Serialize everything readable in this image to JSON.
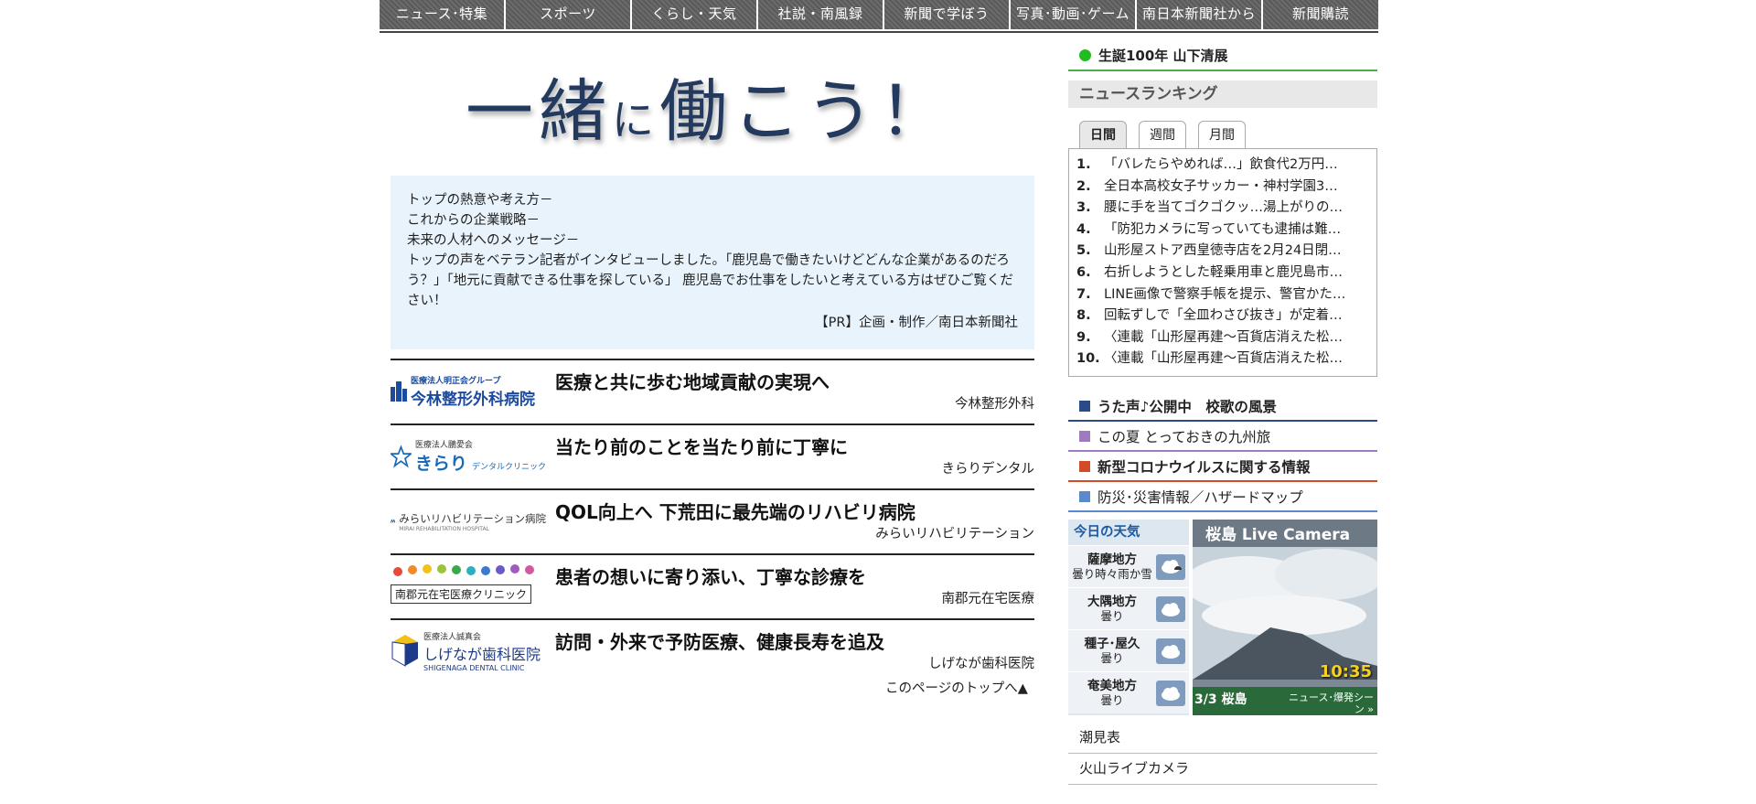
{
  "nav": [
    "ニュース･特集",
    "スポーツ",
    "くらし・天気",
    "社説・南風録",
    "新聞で学ぼう",
    "写真･動画･ゲーム",
    "南日本新聞社から",
    "新聞購読"
  ],
  "hero": {
    "part1": "一緒",
    "part2": "に",
    "part3": "働こう！"
  },
  "intro": {
    "lines": [
      "トップの熱意や考え方－",
      "これからの企業戦略－",
      "未来の人材へのメッセージ－"
    ],
    "body": "トップの声をベテラン記者がインタビューしました。「鹿児島で働きたいけどどんな企業があるのだろう？」「地元に貢献できる仕事を探している」 鹿児島でお仕事をしたいと考えている方はぜひご覧ください！",
    "pr": "【PR】企画・制作／南日本新聞社"
  },
  "articles": [
    {
      "logo_sub": "医療法人明正会グループ",
      "logo_main": "今林整形外科病院",
      "headline": "医療と共に歩む地域貢献の実現へ",
      "sponsor": "今林整形外科"
    },
    {
      "logo_sub": "医療法人鵬愛会",
      "logo_main": "きらり",
      "logo_tag": "デンタルクリニック",
      "headline": "当たり前のことを当たり前に丁寧に",
      "sponsor": "きらりデンタル"
    },
    {
      "logo_main": "みらいリハビリテーション病院",
      "logo_sub": "MIRAI REHABILITATION HOSPITAL",
      "headline": "QOL向上へ 下荒田に最先端のリハビリ病院",
      "sponsor": "みらいリハビリテーション"
    },
    {
      "logo_main": "南郡元在宅医療クリニック",
      "headline": "患者の想いに寄り添い、丁寧な診療を",
      "sponsor": "南郡元在宅医療"
    },
    {
      "logo_sub": "医療法人誠真会",
      "logo_main": "しげなが歯科医院",
      "logo_tag": "SHIGENAGA DENTAL CLINIC",
      "headline": "訪問・外来で予防医療、健康長寿を追及",
      "sponsor": "しげなが歯科医院"
    }
  ],
  "page_top": "このページのトップへ▲",
  "sidebar": {
    "birth": "生誕100年 山下清展",
    "ranking_title": "ニュースランキング",
    "tabs": [
      "日間",
      "週間",
      "月間"
    ],
    "ranking": [
      {
        "num": "1.",
        "text": "「バレたらやめれば…」飲食代2万円…"
      },
      {
        "num": "2.",
        "text": "全日本高校女子サッカー・神村学園3…"
      },
      {
        "num": "3.",
        "text": "腰に手を当てゴクゴクッ…湯上がりの…"
      },
      {
        "num": "4.",
        "text": "「防犯カメラに写っていても逮捕は難…"
      },
      {
        "num": "5.",
        "text": "山形屋ストア西皇徳寺店を2月24日閉…"
      },
      {
        "num": "6.",
        "text": "右折しようとした軽乗用車と鹿児島市…"
      },
      {
        "num": "7.",
        "text": "LINE画像で警察手帳を提示、警官かた…"
      },
      {
        "num": "8.",
        "text": "回転ずしで「全皿わさび抜き」が定着…"
      },
      {
        "num": "9.",
        "text": "〈連載「山形屋再建～百貨店消えた松…"
      },
      {
        "num": "10.",
        "text": "〈連載「山形屋再建～百貨店消えた松…"
      }
    ],
    "banners": [
      {
        "label": "うた声♪公開中　校歌の風景",
        "color": "#2a4a8a"
      },
      {
        "label": "この夏 とっておきの九州旅",
        "color": "#a07ac0"
      },
      {
        "label": "新型コロナウイルスに関する情報",
        "color": "#d24a2a"
      },
      {
        "label": "防災･災害情報／ハザードマップ",
        "color": "#5a8acc"
      }
    ],
    "weather": {
      "title": "今日の天気",
      "areas": [
        {
          "name": "薩摩地方",
          "cond": "曇り時々雨か雪"
        },
        {
          "name": "大隅地方",
          "cond": "曇り"
        },
        {
          "name": "種子･屋久",
          "cond": "曇り"
        },
        {
          "name": "奄美地方",
          "cond": "曇り"
        }
      ]
    },
    "camera": {
      "title": "桜島 Live Camera",
      "time": "10:35",
      "caption1": "3/3 桜島",
      "caption2": "ニュース･爆発シーン »"
    },
    "links": [
      "潮見表",
      "火山ライブカメラ"
    ]
  },
  "colors": {
    "nav_bg": "#5f5f5f",
    "accent_green": "#4cae4c",
    "intro_bg": "#e8f3fb",
    "hero_ink": "#233a5e"
  }
}
